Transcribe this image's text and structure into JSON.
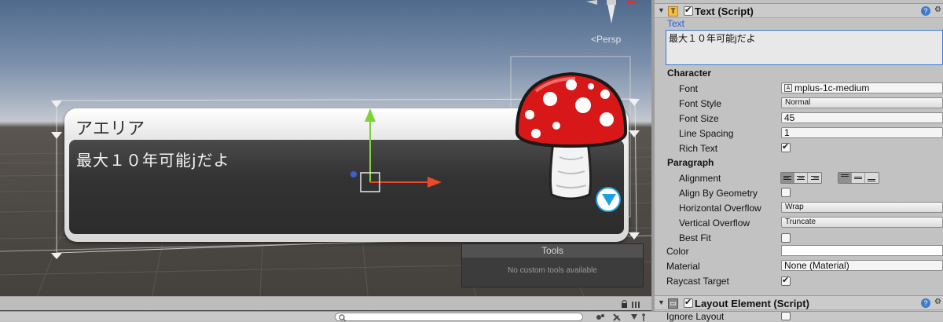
{
  "scene": {
    "persp_label": "<Persp",
    "dialog": {
      "speaker": "アエリア",
      "line": "最大１０年可能jだよ"
    },
    "tools_panel": {
      "title": "Tools",
      "message": "No custom tools available"
    }
  },
  "inspector": {
    "text_component": {
      "title": "Text (Script)",
      "enabled": true,
      "text_label": "Text",
      "text_value": "最大１０年可能jだよ",
      "character_header": "Character",
      "font_label": "Font",
      "font_value": "mplus-1c-medium",
      "font_style_label": "Font Style",
      "font_style_value": "Normal",
      "font_size_label": "Font Size",
      "font_size_value": "45",
      "line_spacing_label": "Line Spacing",
      "line_spacing_value": "1",
      "rich_text_label": "Rich Text",
      "rich_text": true,
      "paragraph_header": "Paragraph",
      "alignment_label": "Alignment",
      "align_geometry_label": "Align By Geometry",
      "align_geometry": false,
      "h_overflow_label": "Horizontal Overflow",
      "h_overflow_value": "Wrap",
      "v_overflow_label": "Vertical Overflow",
      "v_overflow_value": "Truncate",
      "best_fit_label": "Best Fit",
      "best_fit": false,
      "color_label": "Color",
      "color_value": "#ffffff",
      "material_label": "Material",
      "material_value": "None (Material)",
      "raycast_label": "Raycast Target",
      "raycast": true
    },
    "layout_component": {
      "title": "Layout Element (Script)",
      "enabled": true,
      "ignore_layout_label": "Ignore Layout",
      "ignore_layout": false
    }
  },
  "colors": {
    "accent_blue": "#3b7ad6",
    "next_button": "#1ca0e0",
    "mushroom_red": "#d81818"
  }
}
